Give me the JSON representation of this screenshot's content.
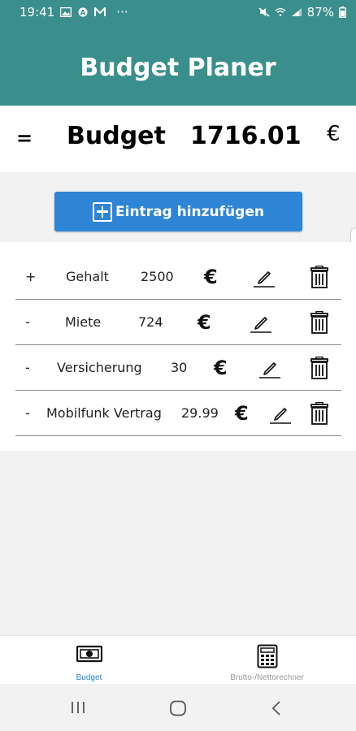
{
  "status_bar": {
    "time": "19:41",
    "battery": "87%",
    "more": "···"
  },
  "app": {
    "title": "Budget Planer"
  },
  "budget": {
    "operator": "=",
    "label": "Budget",
    "value": "1716.01",
    "currency": "€"
  },
  "add_button": {
    "label": "Eintrag hinzufügen"
  },
  "entries": [
    {
      "sign": "+",
      "name": "Gehalt",
      "amount": "2500",
      "currency": "€"
    },
    {
      "sign": "-",
      "name": "Miete",
      "amount": "724",
      "currency": "€"
    },
    {
      "sign": "-",
      "name": "Versicherung",
      "amount": "30",
      "currency": "€"
    },
    {
      "sign": "-",
      "name": "Mobilfunk Vertrag",
      "amount": "29.99",
      "currency": "€"
    }
  ],
  "bottom_nav": {
    "tabs": [
      {
        "label": "Budget",
        "icon": "money-icon",
        "active": true
      },
      {
        "label": "Brutto-/Nettorechner",
        "icon": "calculator-icon",
        "active": false
      }
    ]
  },
  "colors": {
    "primary": "#3a8f8c",
    "accent": "#2f85d5",
    "background": "#f2f2f2"
  }
}
